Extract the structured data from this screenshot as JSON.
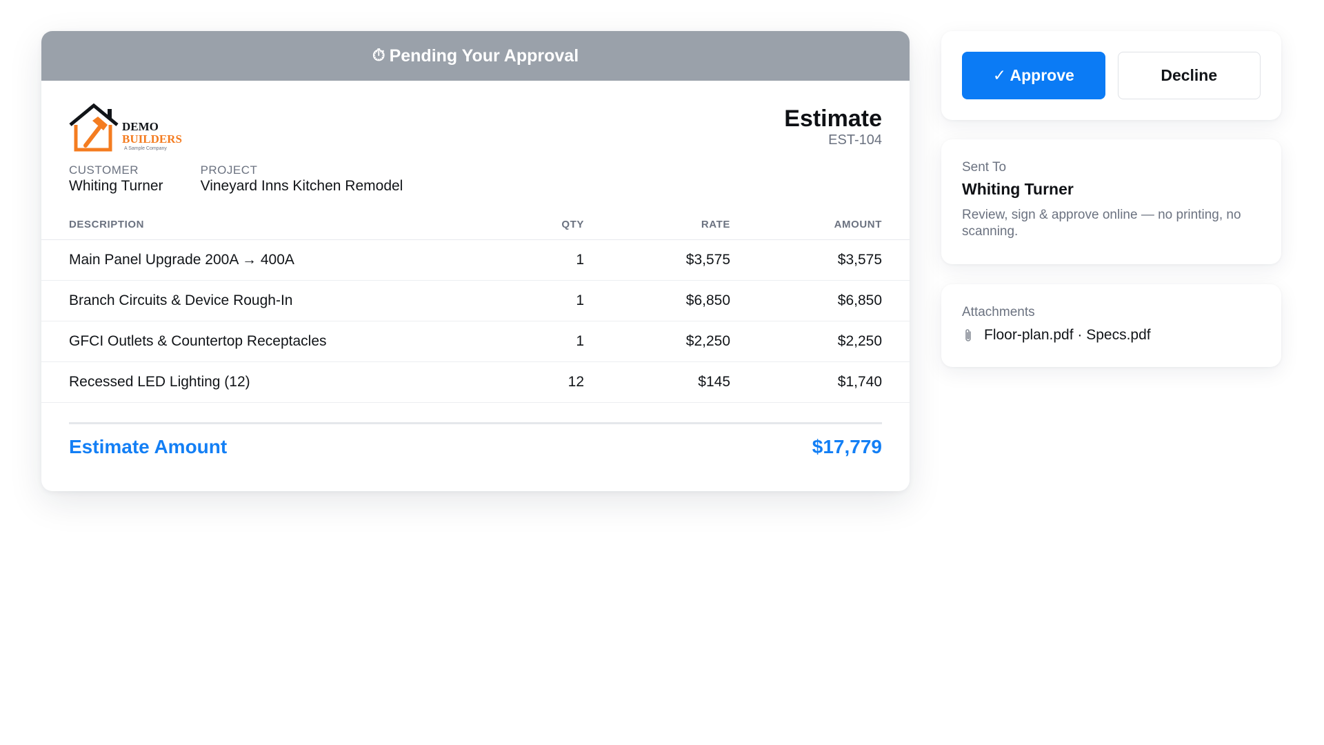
{
  "status": {
    "icon": "stopwatch-icon",
    "text": "Pending Your Approval",
    "color": "#9aa1aa"
  },
  "company": {
    "name_line1": "DEMO",
    "name_line2": "BUILDERS",
    "tagline": "A Sample Company",
    "brand_color": "#f47c20"
  },
  "document": {
    "title": "Estimate",
    "number": "EST-104"
  },
  "meta": {
    "customer_label": "CUSTOMER",
    "customer_value": "Whiting Turner",
    "project_label": "PROJECT",
    "project_value": "Vineyard Inns Kitchen Remodel"
  },
  "table": {
    "headers": [
      "DESCRIPTION",
      "QTY",
      "RATE",
      "AMOUNT"
    ],
    "rows": [
      {
        "description": "Main Panel Upgrade 200A → 400A",
        "qty": "1",
        "rate": "$3,575",
        "amount": "$3,575"
      },
      {
        "description": "Branch Circuits & Device Rough-In",
        "qty": "1",
        "rate": "$6,850",
        "amount": "$6,850"
      },
      {
        "description": "GFCI Outlets & Countertop Receptacles",
        "qty": "1",
        "rate": "$2,250",
        "amount": "$2,250"
      },
      {
        "description": "Recessed LED Lighting (12)",
        "qty": "12",
        "rate": "$145",
        "amount": "$1,740"
      }
    ]
  },
  "total": {
    "label": "Estimate Amount",
    "value": "$17,779",
    "color": "#137ff5"
  },
  "actions": {
    "approve_label": "✓ Approve",
    "decline_label": "Decline",
    "approve_color": "#0b7bf5"
  },
  "sent_to": {
    "label": "Sent To",
    "name": "Whiting Turner",
    "note": "Review, sign & approve online — no printing, no scanning."
  },
  "attachments": {
    "label": "Attachments",
    "icon": "paperclip-icon",
    "files": "Floor-plan.pdf · Specs.pdf"
  }
}
